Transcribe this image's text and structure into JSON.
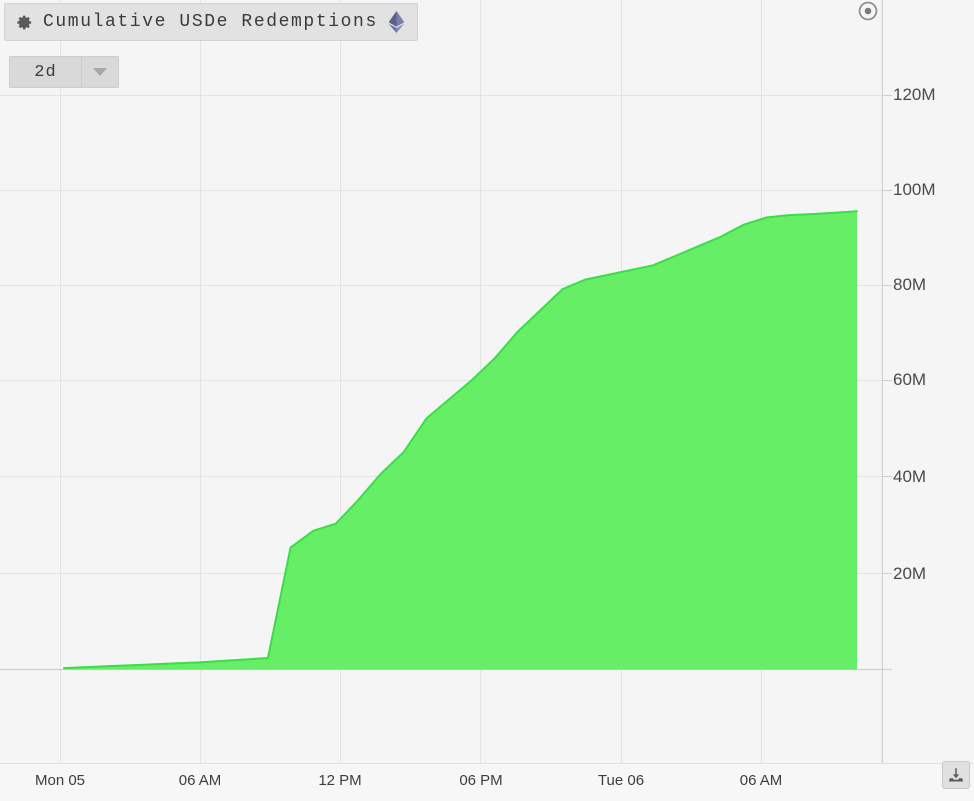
{
  "header": {
    "title": "Cumulative USDe Redemptions",
    "gear_icon": "gear-icon",
    "chain_icon": "ethereum-icon",
    "record_icon": "record-target-icon"
  },
  "range_selector": {
    "value": "2d",
    "caret_icon": "chevron-down-icon"
  },
  "footer": {
    "download_icon": "download-icon"
  },
  "colors": {
    "area_fill": "#66ef66",
    "area_stroke": "#3ddb4a",
    "plot_background": "#f5f5f5",
    "gridline": "#e3e3e3",
    "axis_line": "#d0d0d0",
    "panel_background": "#f7f7f7",
    "button_background": "#d9d9d9",
    "title_background": "#e2e2e2",
    "eth_logo": "#6c6f9e",
    "text": "#3b3b3b"
  },
  "chart_data": {
    "type": "area",
    "title": "Cumulative USDe Redemptions",
    "xlabel": "",
    "ylabel": "",
    "grid": true,
    "legend": null,
    "ylim": [
      0,
      130000000
    ],
    "ytick_labels": [
      "120M",
      "100M",
      "80M",
      "60M",
      "40M",
      "20M"
    ],
    "ytick_values": [
      120000000,
      100000000,
      80000000,
      60000000,
      40000000,
      20000000
    ],
    "xtick_labels": [
      "Mon 05",
      "06 AM",
      "12 PM",
      "06 PM",
      "Tue 06",
      "06 AM"
    ],
    "series": [
      {
        "name": "Cumulative USDe Redemptions",
        "x": [
          "Mon 05 00:00",
          "Mon 05 01:00",
          "Mon 05 02:00",
          "Mon 05 03:00",
          "Mon 05 04:00",
          "Mon 05 05:00",
          "Mon 05 06:00",
          "Mon 05 07:00",
          "Mon 05 08:00",
          "Mon 05 08:30",
          "Mon 05 09:00",
          "Mon 05 09:30",
          "Mon 05 10:00",
          "Mon 05 10:30",
          "Mon 05 11:00",
          "Mon 05 11:30",
          "Mon 05 12:00",
          "Mon 05 12:30",
          "Mon 05 13:00",
          "Mon 05 13:30",
          "Mon 05 14:00",
          "Mon 05 14:30",
          "Mon 05 15:00",
          "Mon 05 16:00",
          "Mon 05 17:00",
          "Mon 05 18:00",
          "Mon 05 19:00",
          "Mon 05 20:00",
          "Mon 05 21:00",
          "Mon 05 22:00",
          "Mon 05 23:00",
          "Tue 06 00:00",
          "Tue 06 03:00",
          "Tue 06 06:00",
          "Tue 06 09:00",
          "Tue 06 11:00"
        ],
        "values": [
          300000,
          500000,
          700000,
          900000,
          1100000,
          1300000,
          1500000,
          1800000,
          2100000,
          2400000,
          25500000,
          29000000,
          30500000,
          35500000,
          41000000,
          45500000,
          52500000,
          56500000,
          60500000,
          65000000,
          70500000,
          75000000,
          79500000,
          81500000,
          82500000,
          83500000,
          84500000,
          86500000,
          88500000,
          90500000,
          93000000,
          94500000,
          95000000,
          95200000,
          95500000,
          95800000
        ]
      }
    ],
    "summary": {
      "start_value": 300000,
      "peak_value": 95800000,
      "peak_label": "~96M",
      "steep_rise_at": "Mon 05 09:00"
    }
  }
}
